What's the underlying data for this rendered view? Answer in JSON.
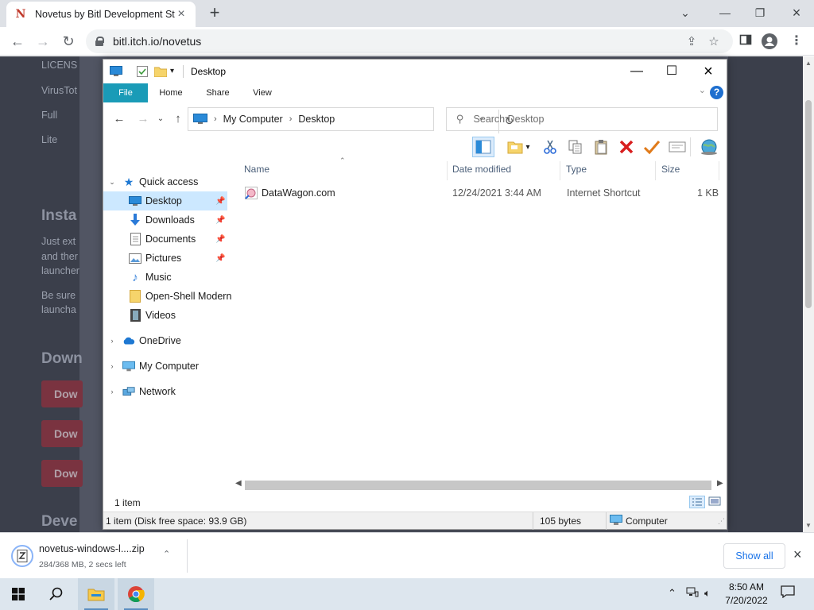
{
  "browser": {
    "tab_title": "Novetus by Bitl Development Stu",
    "favicon": "N",
    "url": "bitl.itch.io/novetus"
  },
  "page": {
    "lines": [
      "LICENS",
      "VirusTot",
      "Full",
      "Lite"
    ],
    "heading_install": "Insta",
    "para": [
      "Just ext",
      "and ther",
      "launcher",
      "Be sure",
      "launcha"
    ],
    "heading_download": "Down",
    "dl_buttons": [
      "Dow",
      "Dow",
      "Dow"
    ],
    "heading_dev": "Deve"
  },
  "explorer": {
    "title": "Desktop",
    "ribbon_tabs": [
      "File",
      "Home",
      "Share",
      "View"
    ],
    "breadcrumb": [
      "My Computer",
      "Desktop"
    ],
    "search_placeholder": "Search Desktop",
    "nav": {
      "quick_access": "Quick access",
      "items": [
        "Desktop",
        "Downloads",
        "Documents",
        "Pictures",
        "Music",
        "Open-Shell Modern",
        "Videos"
      ],
      "onedrive": "OneDrive",
      "my_computer": "My Computer",
      "network": "Network"
    },
    "columns": [
      "Name",
      "Date modified",
      "Type",
      "Size"
    ],
    "files": [
      {
        "name": "DataWagon.com",
        "date": "12/24/2021 3:44 AM",
        "type": "Internet Shortcut",
        "size": "1 KB"
      }
    ],
    "status_count": "1 item",
    "status_disk": "1 item (Disk free space: 93.9 GB)",
    "status_bytes": "105 bytes",
    "status_location": "Computer"
  },
  "download": {
    "filename": "novetus-windows-l....zip",
    "status": "284/368 MB, 2 secs left",
    "show_all": "Show all"
  },
  "taskbar": {
    "time": "8:50 AM",
    "date": "7/20/2022"
  }
}
